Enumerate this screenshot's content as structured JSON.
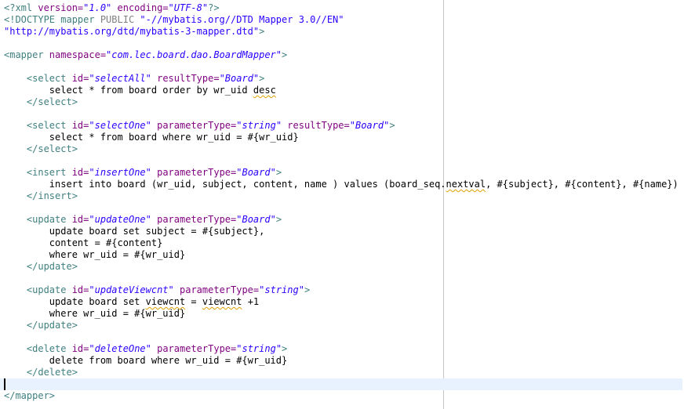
{
  "editor": {
    "lines": [
      [
        {
          "t": "<?xml ",
          "c": "decl"
        },
        {
          "t": "version=",
          "c": "attr"
        },
        {
          "t": "\"1.0\"",
          "c": "val"
        },
        {
          "t": " encoding=",
          "c": "attr"
        },
        {
          "t": "\"UTF-8\"",
          "c": "val"
        },
        {
          "t": "?>",
          "c": "decl"
        }
      ],
      [
        {
          "t": "<!DOCTYPE mapper ",
          "c": "tag"
        },
        {
          "t": "PUBLIC ",
          "c": "doctype"
        },
        {
          "t": "\"-//mybatis.org//DTD Mapper 3.0//EN\"",
          "c": "str"
        }
      ],
      [
        {
          "t": "\"http://mybatis.org/dtd/mybatis-3-mapper.dtd\"",
          "c": "str"
        },
        {
          "t": ">",
          "c": "tag"
        }
      ],
      [],
      [
        {
          "t": "<mapper ",
          "c": "tag"
        },
        {
          "t": "namespace=",
          "c": "attr"
        },
        {
          "t": "\"com.lec.board.dao.BoardMapper\"",
          "c": "val"
        },
        {
          "t": ">",
          "c": "tag"
        }
      ],
      [],
      [
        {
          "t": "    <select ",
          "c": "tag"
        },
        {
          "t": "id=",
          "c": "attr"
        },
        {
          "t": "\"selectAll\"",
          "c": "val"
        },
        {
          "t": " resultType=",
          "c": "attr"
        },
        {
          "t": "\"Board\"",
          "c": "val"
        },
        {
          "t": ">",
          "c": "tag"
        }
      ],
      [
        {
          "t": "        select * from board order by wr_uid ",
          "c": "text"
        },
        {
          "t": "desc",
          "c": "text",
          "sq": true
        }
      ],
      [
        {
          "t": "    </select>",
          "c": "tag"
        }
      ],
      [],
      [
        {
          "t": "    <select ",
          "c": "tag"
        },
        {
          "t": "id=",
          "c": "attr"
        },
        {
          "t": "\"selectOne\"",
          "c": "val"
        },
        {
          "t": " parameterType=",
          "c": "attr"
        },
        {
          "t": "\"string\"",
          "c": "val"
        },
        {
          "t": " resultType=",
          "c": "attr"
        },
        {
          "t": "\"Board\"",
          "c": "val"
        },
        {
          "t": ">",
          "c": "tag"
        }
      ],
      [
        {
          "t": "        select * from board where wr_uid = #{wr_uid}",
          "c": "text"
        }
      ],
      [
        {
          "t": "    </select>",
          "c": "tag"
        }
      ],
      [],
      [
        {
          "t": "    <insert ",
          "c": "tag"
        },
        {
          "t": "id=",
          "c": "attr"
        },
        {
          "t": "\"insertOne\"",
          "c": "val"
        },
        {
          "t": " parameterType=",
          "c": "attr"
        },
        {
          "t": "\"Board\"",
          "c": "val"
        },
        {
          "t": ">",
          "c": "tag"
        }
      ],
      [
        {
          "t": "        insert into board (wr_uid, subject, content, name ) values (board_seq.",
          "c": "text"
        },
        {
          "t": "nextval",
          "c": "text",
          "sq": true
        },
        {
          "t": ", #{subject}, #{content}, #{name})",
          "c": "text"
        }
      ],
      [
        {
          "t": "    </insert>",
          "c": "tag"
        }
      ],
      [],
      [
        {
          "t": "    <update ",
          "c": "tag"
        },
        {
          "t": "id=",
          "c": "attr"
        },
        {
          "t": "\"updateOne\"",
          "c": "val"
        },
        {
          "t": " parameterType=",
          "c": "attr"
        },
        {
          "t": "\"Board\"",
          "c": "val"
        },
        {
          "t": ">",
          "c": "tag"
        }
      ],
      [
        {
          "t": "        update board set subject = #{subject},",
          "c": "text"
        }
      ],
      [
        {
          "t": "        content = #{content}",
          "c": "text"
        }
      ],
      [
        {
          "t": "        where wr_uid = #{wr_uid}",
          "c": "text"
        }
      ],
      [
        {
          "t": "    </update>",
          "c": "tag"
        }
      ],
      [],
      [
        {
          "t": "    <update ",
          "c": "tag"
        },
        {
          "t": "id=",
          "c": "attr"
        },
        {
          "t": "\"updateViewcnt\"",
          "c": "val"
        },
        {
          "t": " parameterType=",
          "c": "attr"
        },
        {
          "t": "\"string\"",
          "c": "val"
        },
        {
          "t": ">",
          "c": "tag"
        }
      ],
      [
        {
          "t": "        update board set ",
          "c": "text"
        },
        {
          "t": "viewcnt",
          "c": "text",
          "sq": true
        },
        {
          "t": " = ",
          "c": "text"
        },
        {
          "t": "viewcnt",
          "c": "text",
          "sq": true
        },
        {
          "t": " +1",
          "c": "text"
        }
      ],
      [
        {
          "t": "        where wr_uid = #{wr_uid}",
          "c": "text"
        }
      ],
      [
        {
          "t": "    </update>",
          "c": "tag"
        }
      ],
      [],
      [
        {
          "t": "    <delete ",
          "c": "tag"
        },
        {
          "t": "id=",
          "c": "attr"
        },
        {
          "t": "\"deleteOne\"",
          "c": "val"
        },
        {
          "t": " parameterType=",
          "c": "attr"
        },
        {
          "t": "\"string\"",
          "c": "val"
        },
        {
          "t": ">",
          "c": "tag"
        }
      ],
      [
        {
          "t": "        delete from board where wr_uid = #{wr_uid}",
          "c": "text"
        }
      ],
      [
        {
          "t": "    </delete>",
          "c": "tag"
        }
      ],
      [],
      [
        {
          "t": "</mapper>",
          "c": "tag"
        }
      ]
    ],
    "current_line_index": 32
  },
  "colors": {
    "tag": "#3f7f7f",
    "attribute": "#7f007f",
    "value": "#2a00ff",
    "text": "#000000",
    "current_line_highlight": "#e8f2fe"
  }
}
